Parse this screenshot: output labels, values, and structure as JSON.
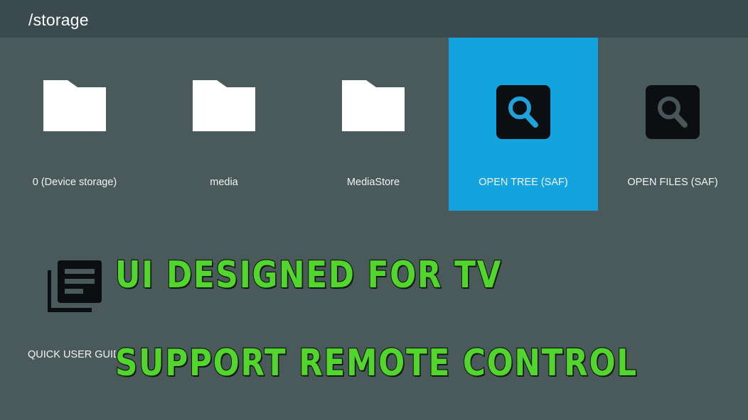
{
  "header": {
    "path": "/storage"
  },
  "tiles": [
    {
      "label": "0 (Device storage)",
      "icon": "folder-icon"
    },
    {
      "label": "media",
      "icon": "folder-icon"
    },
    {
      "label": "MediaStore",
      "icon": "folder-icon"
    },
    {
      "label": "OPEN TREE (SAF)",
      "icon": "search-icon",
      "selected": true
    },
    {
      "label": "OPEN FILES (SAF)",
      "icon": "search-icon"
    }
  ],
  "guide": {
    "label": "QUICK USER GUIDE",
    "icon": "library-books-icon"
  },
  "promo": {
    "line1": "UI DESIGNED FOR TV",
    "line2": "SUPPORT REMOTE CONTROL"
  },
  "colors": {
    "background": "#4a5a5b",
    "topbar": "#3b4a4e",
    "selected_tile": "#13a3df",
    "promo_text": "#52d62d",
    "search_accent": "#1ea3da"
  }
}
